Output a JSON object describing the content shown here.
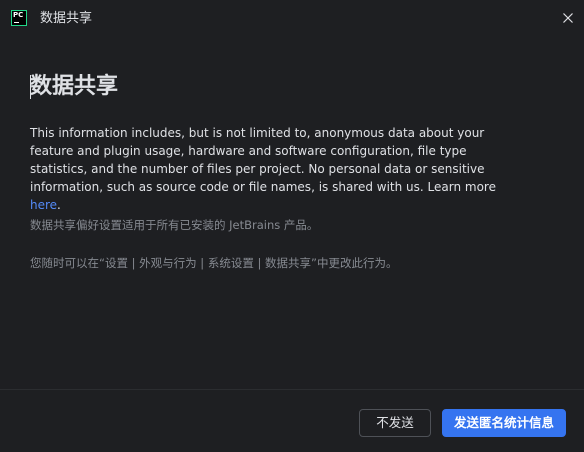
{
  "window": {
    "title": "数据共享",
    "app_icon_text": "PC",
    "close_icon": "close-icon"
  },
  "content": {
    "heading": "数据共享",
    "paragraph": "This information includes, but is not limited to, anonymous data about your feature and plugin usage, hardware and software configuration, file type statistics, and the number of files per project. No personal data or sensitive information, such as source code or file names, is shared with us. Learn more ",
    "link_text": "here",
    "paragraph_end": ".",
    "note1": "数据共享偏好设置适用于所有已安装的 JetBrains 产品。",
    "note2": "您随时可以在“设置 | 外观与行为 | 系统设置 | 数据共享”中更改此行为。"
  },
  "buttons": {
    "decline": "不发送",
    "accept": "发送匿名统计信息"
  },
  "colors": {
    "background": "#1e1f22",
    "text": "#dfe1e5",
    "muted_text": "#868a91",
    "link": "#548af7",
    "primary_button": "#3574f0"
  }
}
